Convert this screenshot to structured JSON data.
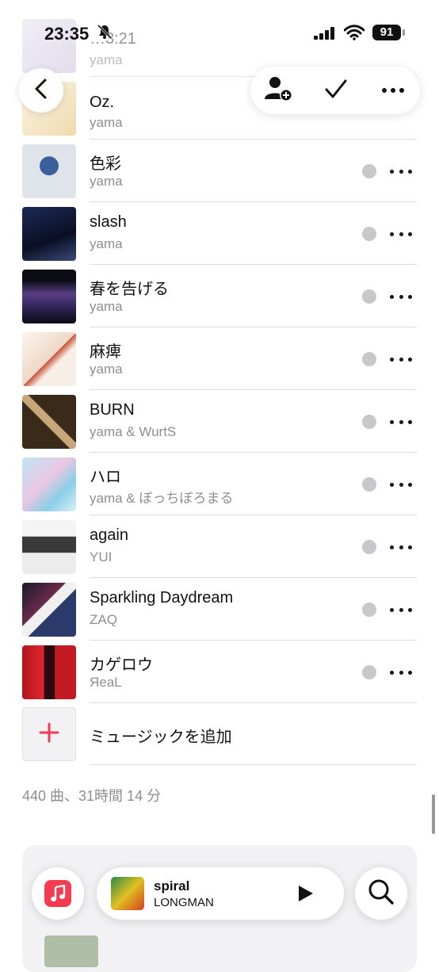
{
  "status_bar": {
    "time": "23:35",
    "battery": "91"
  },
  "partial_rows": [
    {
      "title": "…3:21",
      "artist": "yama"
    },
    {
      "title": "Oz.",
      "artist": "yama"
    }
  ],
  "tracks": [
    {
      "title": "色彩",
      "artist": "yama"
    },
    {
      "title": "slash",
      "artist": "yama"
    },
    {
      "title": "春を告げる",
      "artist": "yama"
    },
    {
      "title": "麻痺",
      "artist": "yama"
    },
    {
      "title": "BURN",
      "artist": "yama & WurtS"
    },
    {
      "title": "ハロ",
      "artist": "yama & ぼっちぼろまる"
    },
    {
      "title": "again",
      "artist": "YUI"
    },
    {
      "title": "Sparkling Daydream",
      "artist": "ZAQ"
    },
    {
      "title": "カゲロウ",
      "artist": "ЯeaL"
    }
  ],
  "add_music_label": "ミュージックを追加",
  "summary": "440 曲、31時間 14 分",
  "now_playing": {
    "title": "spiral",
    "artist": "LONGMAN"
  },
  "colors": {
    "accent": "#f43b4f",
    "secondary_text": "#8e8e93",
    "separator": "#dcdcdc"
  },
  "icons": [
    "back-chevron-icon",
    "add-person-icon",
    "checkmark-icon",
    "more-icon",
    "download-icon",
    "plus-icon",
    "music-app-icon",
    "play-icon",
    "search-icon",
    "bell-slash-icon",
    "cellular-signal-icon",
    "wifi-icon"
  ]
}
